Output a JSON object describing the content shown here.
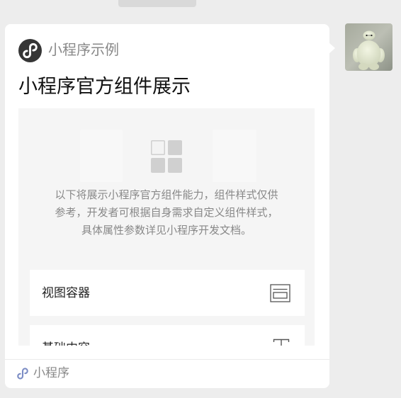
{
  "colors": {
    "chat_background": "#ededed",
    "card_background": "#ffffff",
    "preview_background": "#f5f5f5",
    "logo_background": "#363636",
    "footer_icon": "#7b8cc4",
    "secondary_text": "#888888"
  },
  "message": {
    "app_icon": "mini-program-logo-icon",
    "app_name": "小程序示例",
    "title": "小程序官方组件展示",
    "preview": {
      "icon": "component-grid-icon",
      "intro_lines": [
        "以下将展示小程序官方组件能力，组件样式仅供",
        "参考，开发者可根据自身需求自定义组件样式，",
        "具体属性参数详见小程序开发文档。"
      ],
      "items": [
        {
          "label": "视图容器",
          "icon": "view-container-icon"
        },
        {
          "label": "基础内容",
          "icon": "text-icon"
        }
      ]
    },
    "footer": {
      "icon": "mini-program-icon",
      "label": "小程序"
    }
  }
}
